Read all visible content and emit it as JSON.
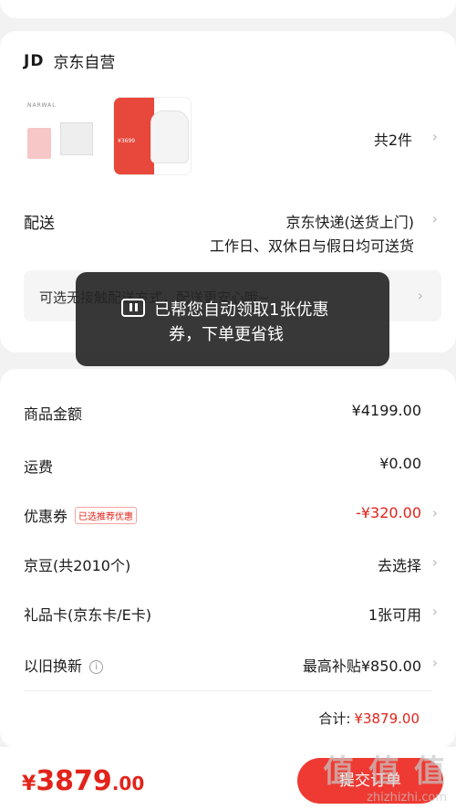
{
  "shop": {
    "logo": "JD",
    "name": "京东自营"
  },
  "goods": {
    "count_text": "共2件",
    "thumb1_brand": "NARWAL",
    "thumb2_price": "¥3699"
  },
  "shipping": {
    "label": "配送",
    "method": "京东快递(送货上门)",
    "note": "工作日、双休日与假日均可送货",
    "contactless": "可选无接触配送方式，配送更安心哦~"
  },
  "toast": {
    "line1": "已帮您自动领取1张优惠",
    "line2": "券，下单更省钱"
  },
  "price_rows": [
    {
      "label": "商品金额",
      "value": "¥4199.00"
    },
    {
      "label": "运费",
      "value": "¥0.00"
    },
    {
      "label": "优惠券",
      "tag": "已选推荐优惠",
      "value": "-¥320.00"
    },
    {
      "label": "京豆(共2010个)",
      "value": "去选择"
    },
    {
      "label": "礼品卡(京东卡/E卡)",
      "value": "1张可用"
    },
    {
      "label": "以旧换新",
      "info": "i",
      "value": "最高补贴¥850.00"
    }
  ],
  "total": {
    "label": "合计:",
    "amount": "¥3879.00"
  },
  "bottom": {
    "yen": "¥",
    "price_int": "3879",
    "price_dec": ".00",
    "submit_label": "提交订单"
  },
  "watermark": {
    "main": "值 值 值",
    "sub": "zhizhizhi.com"
  },
  "colors": {
    "accent": "#e2231a",
    "button": "#ee3a32",
    "toast_bg": "#222222"
  },
  "icons": [
    "chevron-right-icon",
    "coupon-icon",
    "info-icon"
  ]
}
